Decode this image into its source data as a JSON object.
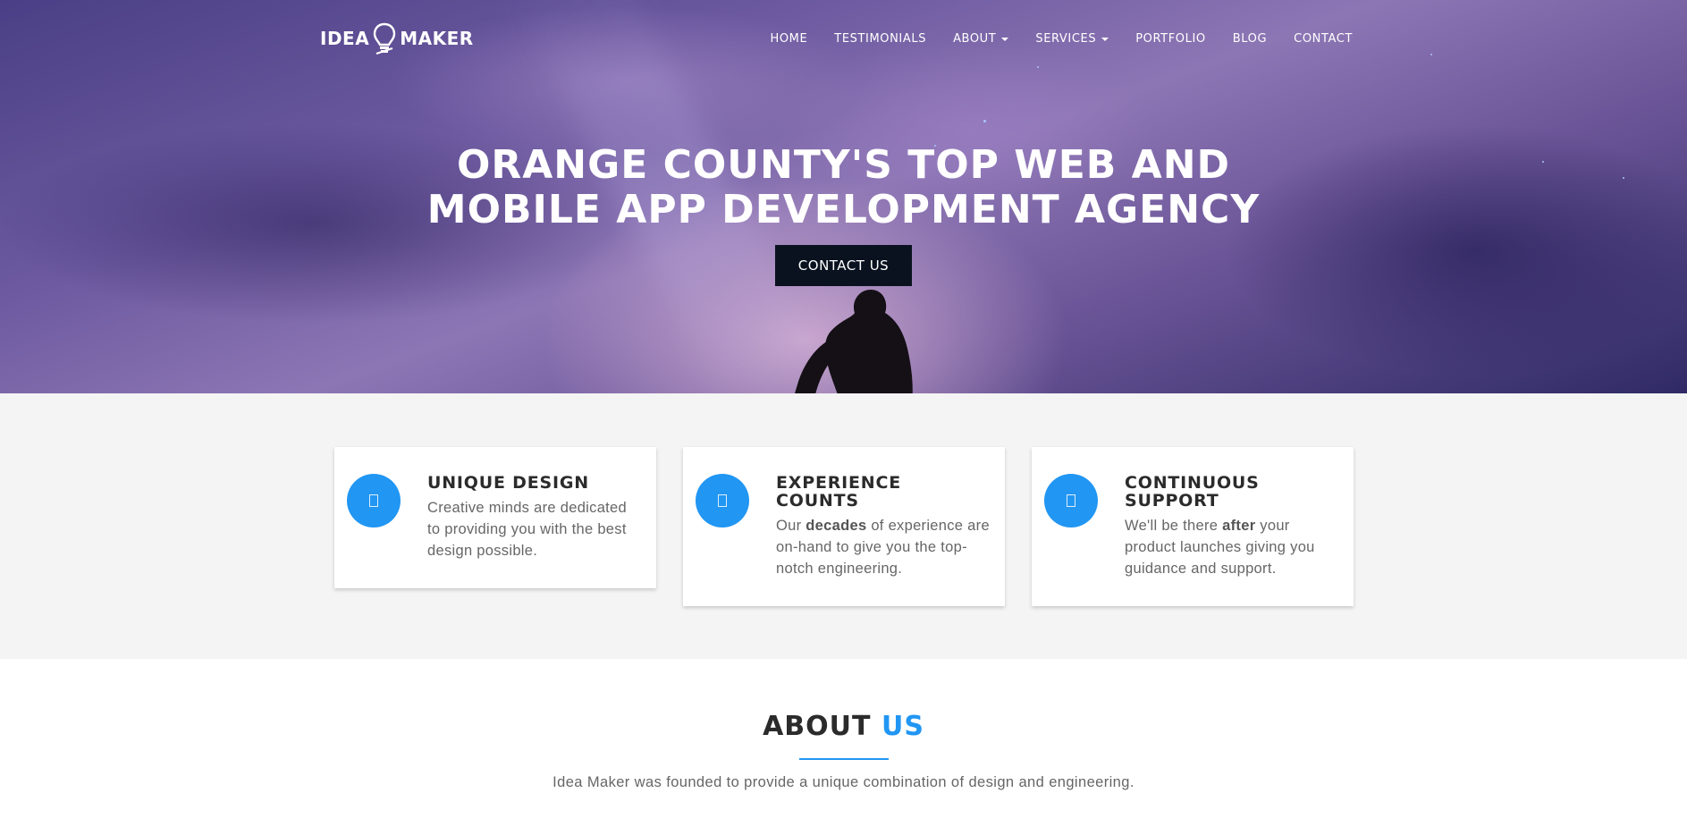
{
  "brand": {
    "logo_left": "IDEA",
    "logo_right": "MAKER"
  },
  "nav": {
    "home": "HOME",
    "testimonials": "TESTIMONIALS",
    "about": "ABOUT",
    "services": "SERVICES",
    "portfolio": "PORTFOLIO",
    "blog": "BLOG",
    "contact": "CONTACT"
  },
  "hero": {
    "title_line1": "ORANGE COUNTY'S TOP WEB AND",
    "title_line2": "MOBILE APP DEVELOPMENT AGENCY",
    "cta_label": "CONTACT US"
  },
  "features": [
    {
      "title": "UNIQUE DESIGN",
      "text": "Creative minds are dedicated to providing you with the best design possible."
    },
    {
      "title": "EXPERIENCE COUNTS",
      "text_pre": "Our ",
      "text_bold": "decades",
      "text_post": " of experience are on-hand to give you the top-notch engineering."
    },
    {
      "title": "CONTINUOUS SUPPORT",
      "text_pre": "We'll be there ",
      "text_bold": "after",
      "text_post": " your product launches giving you guidance and support."
    }
  ],
  "about": {
    "heading_main": "ABOUT",
    "heading_accent": "US",
    "intro": "Idea Maker was founded to provide a unique combination of design and engineering."
  },
  "colors": {
    "accent": "#2196f3",
    "cta_bg": "#0a1220",
    "section_bg": "#f4f4f4"
  },
  "icons": {
    "logo": "lightbulb-icon",
    "feature_icons": [
      "design-icon",
      "experience-icon",
      "support-icon"
    ]
  }
}
